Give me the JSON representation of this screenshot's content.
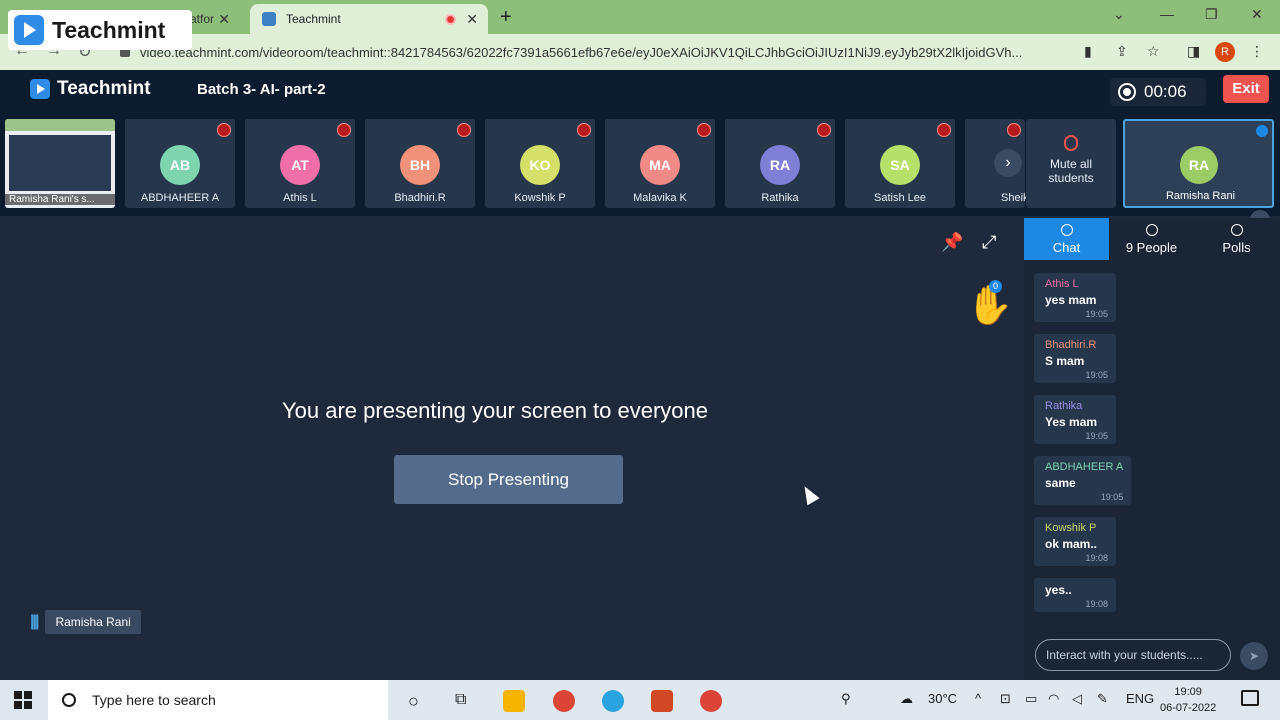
{
  "browser": {
    "tab_inactive_partial": "atfor",
    "tab_active_title": "Teachmint",
    "url": "video.teachmint.com/videoroom/teachmint::8421784563/62022fc7391a5661efb67e6e/eyJ0eXAiOiJKV1QiLCJhbGciOiJIUzI1NiJ9.eyJyb29tX2lkIjoidGVh...",
    "profile_initial": "R",
    "logo_overlay_text": "Teachmint"
  },
  "app": {
    "brand": "Teachmint",
    "class_title": "Batch 3- AI- part-2",
    "timer": "00:06",
    "exit_label": "Exit"
  },
  "participants": [
    {
      "initials": "AB",
      "name": "ABDHAHEER A",
      "color": "#7fd4b0"
    },
    {
      "initials": "AT",
      "name": "Athis L",
      "color": "#f06fa8"
    },
    {
      "initials": "BH",
      "name": "Bhadhiri.R",
      "color": "#f0927a"
    },
    {
      "initials": "KO",
      "name": "Kowshik P",
      "color": "#d4e06a"
    },
    {
      "initials": "MA",
      "name": "Malavika K",
      "color": "#f08a86"
    },
    {
      "initials": "RA",
      "name": "Rathika",
      "color": "#7f7fd8"
    },
    {
      "initials": "SA",
      "name": "Satish Lee",
      "color": "#b6e06a"
    },
    {
      "initials": "",
      "name": "Sheik P",
      "color": "#e06ab6"
    }
  ],
  "screen_share_tile_name": "Ramisha Rani's s...",
  "mute_all_label": "Mute all students",
  "self": {
    "initials": "RA",
    "name": "Ramisha Rani"
  },
  "stage": {
    "message": "You are presenting your screen to everyone",
    "stop_button": "Stop Presenting",
    "hand_count": "0",
    "speaker_name": "Ramisha Rani"
  },
  "panel": {
    "tabs": [
      "Chat",
      "9 People",
      "Polls"
    ],
    "messages": [
      {
        "sender": "Athis L",
        "text": "yes mam",
        "time": "19:05",
        "color": "#f06fa8"
      },
      {
        "sender": "Bhadhiri.R",
        "text": "S mam",
        "time": "19:05",
        "color": "#f0927a"
      },
      {
        "sender": "Rathika",
        "text": "Yes mam",
        "time": "19:05",
        "color": "#9b8fe8"
      },
      {
        "sender": "ABDHAHEER A",
        "text": "same",
        "time": "19:05",
        "color": "#7fd4b0"
      },
      {
        "sender": "Kowshik P",
        "text": "ok mam..",
        "time": "19:08",
        "color": "#c9d86a"
      },
      {
        "sender": "",
        "text": "yes..",
        "time": "19:08",
        "color": "#ffffff"
      }
    ],
    "input_placeholder": "Interact with your students....."
  },
  "taskbar": {
    "search_placeholder": "Type here to search",
    "weather": "30°C",
    "lang": "ENG",
    "time": "19:09",
    "date": "06-07-2022"
  }
}
